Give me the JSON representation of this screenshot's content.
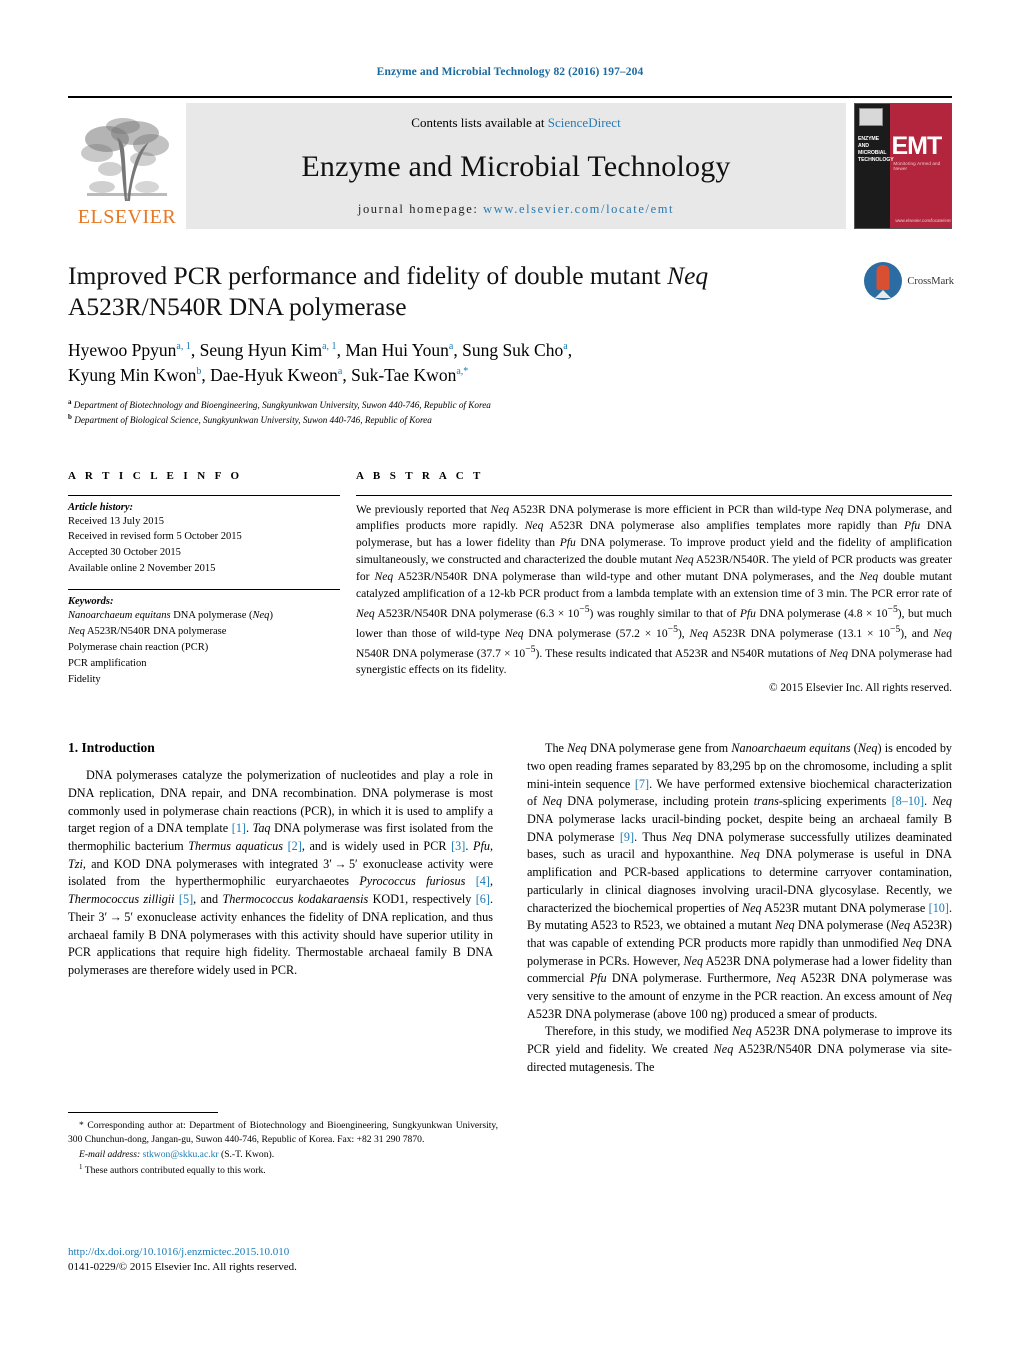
{
  "running_head": "Enzyme and Microbial Technology 82 (2016) 197–204",
  "banner": {
    "publisher_logo_label": "ELSEVIER",
    "contents_prefix": "Contents lists available at ",
    "contents_link": "ScienceDirect",
    "journal_title": "Enzyme and Microbial Technology",
    "homepage_prefix": "journal homepage: ",
    "homepage_url": "www.elsevier.com/locate/emt",
    "cover": {
      "acronym": "EMT",
      "journal_name": "ENZYME AND MICROBIAL TECHNOLOGY",
      "tagline": "Monitoring Armed and Newer",
      "url": "www.elsevier.com/locate/emt"
    }
  },
  "title": {
    "line1_pre": "Improved PCR performance and fidelity of double mutant ",
    "line1_italic": "Neq",
    "line2": "A523R/N540R DNA polymerase",
    "crossmark_label": "CrossMark"
  },
  "authors": {
    "line1": "Hyewoo Ppyun",
    "sup1": "a, 1",
    "a2": "Seung Hyun Kim",
    "sup2": "a, 1",
    "a3": "Man Hui Youn",
    "sup3": "a",
    "a4": "Sung Suk Cho",
    "sup4": "a",
    "a5": "Kyung Min Kwon",
    "sup5": "b",
    "a6": "Dae-Hyuk Kweon",
    "sup6": "a",
    "a7": "Suk-Tae Kwon",
    "sup7": "a,*"
  },
  "affiliations": [
    {
      "marker": "a",
      "text": "Department of Biotechnology and Bioengineering, Sungkyunkwan University, Suwon 440-746, Republic of Korea"
    },
    {
      "marker": "b",
      "text": "Department of Biological Science, Sungkyunkwan University, Suwon 440-746, Republic of Korea"
    }
  ],
  "article_info": {
    "heading": "A R T I C L E   I N F O",
    "history_label": "Article history:",
    "history": [
      "Received 13 July 2015",
      "Received in revised form 5 October 2015",
      "Accepted 30 October 2015",
      "Available online 2 November 2015"
    ],
    "keywords_label": "Keywords:",
    "keywords": [
      "Nanoarchaeum equitans DNA polymerase (Neq)",
      "Neq A523R/N540R DNA polymerase",
      "Polymerase chain reaction (PCR)",
      "PCR amplification",
      "Fidelity"
    ]
  },
  "abstract": {
    "heading": "A B S T R A C T",
    "text": "We previously reported that Neq A523R DNA polymerase is more efficient in PCR than wild-type Neq DNA polymerase, and amplifies products more rapidly. Neq A523R DNA polymerase also amplifies templates more rapidly than Pfu DNA polymerase, but has a lower fidelity than Pfu DNA polymerase. To improve product yield and the fidelity of amplification simultaneously, we constructed and characterized the double mutant Neq A523R/N540R. The yield of PCR products was greater for Neq A523R/N540R DNA polymerase than wild-type and other mutant DNA polymerases, and the Neq double mutant catalyzed amplification of a 12-kb PCR product from a lambda template with an extension time of 3 min. The PCR error rate of Neq A523R/N540R DNA polymerase (6.3 × 10−5) was roughly similar to that of Pfu DNA polymerase (4.8 × 10−5), but much lower than those of wild-type Neq DNA polymerase (57.2 × 10−5), Neq A523R DNA polymerase (13.1 × 10−5), and Neq N540R DNA polymerase (37.7 × 10−5). These results indicated that A523R and N540R mutations of Neq DNA polymerase had synergistic effects on its fidelity.",
    "copyright": "© 2015 Elsevier Inc. All rights reserved."
  },
  "introduction": {
    "heading": "1.  Introduction",
    "left_para1": "DNA polymerases catalyze the polymerization of nucleotides and play a role in DNA replication, DNA repair, and DNA recombination. DNA polymerase is most commonly used in polymerase chain reactions (PCR), in which it is used to amplify a target region of a DNA template [1]. Taq DNA polymerase was first isolated from the thermophilic bacterium Thermus aquaticus [2], and is widely used in PCR [3]. Pfu, Tzi, and KOD DNA polymerases with integrated 3′ → 5′ exonuclease activity were isolated from the hyperthermophilic euryarchaeotes Pyrococcus furiosus [4], Thermococcus zilligii [5], and Thermococcus kodakaraensis KOD1, respectively [6]. Their 3′ → 5′ exonuclease activity enhances the fidelity of DNA replication, and thus archaeal family B DNA polymerases with this activity should have superior utility in PCR applications that require high fidelity. Thermostable archaeal family B DNA polymerases are therefore widely used in PCR.",
    "right_para1": "The Neq DNA polymerase gene from Nanoarchaeum equitans (Neq) is encoded by two open reading frames separated by 83,295 bp on the chromosome, including a split mini-intein sequence [7]. We have performed extensive biochemical characterization of Neq DNA polymerase, including protein trans-splicing experiments [8–10]. Neq DNA polymerase lacks uracil-binding pocket, despite being an archaeal family B DNA polymerase [9]. Thus Neq DNA polymerase successfully utilizes deaminated bases, such as uracil and hypoxanthine. Neq DNA polymerase is useful in DNA amplification and PCR-based applications to determine carryover contamination, particularly in clinical diagnoses involving uracil-DNA glycosylase. Recently, we characterized the biochemical properties of Neq A523R mutant DNA polymerase [10]. By mutating A523 to R523, we obtained a mutant Neq DNA polymerase (Neq A523R) that was capable of extending PCR products more rapidly than unmodified Neq DNA polymerase in PCRs. However, Neq A523R DNA polymerase had a lower fidelity than commercial Pfu DNA polymerase. Furthermore, Neq A523R DNA polymerase was very sensitive to the amount of enzyme in the PCR reaction. An excess amount of Neq A523R DNA polymerase (above 100 ng) produced a smear of products.",
    "right_para2": "Therefore, in this study, we modified Neq A523R DNA polymerase to improve its PCR yield and fidelity. We created Neq A523R/N540R DNA polymerase via site-directed mutagenesis. The"
  },
  "footnotes": {
    "corresponding": "* Corresponding author at: Department of Biotechnology and Bioengineering, Sungkyunkwan University, 300 Chunchun-dong, Jangan-gu, Suwon 440-746, Republic of Korea. Fax: +82 31 290 7870.",
    "email_label": "E-mail address:",
    "email": "stkwon@skku.ac.kr",
    "email_suffix": "(S.-T. Kwon).",
    "equal_contrib": "These authors contributed equally to this work."
  },
  "footer": {
    "doi": "http://dx.doi.org/10.1016/j.enzmictec.2015.10.010",
    "issn": "0141-0229/© 2015 Elsevier Inc. All rights reserved."
  },
  "colors": {
    "link": "#1a7ab5",
    "elsevier_orange": "#E87722",
    "cover_red": "#b2253c"
  }
}
